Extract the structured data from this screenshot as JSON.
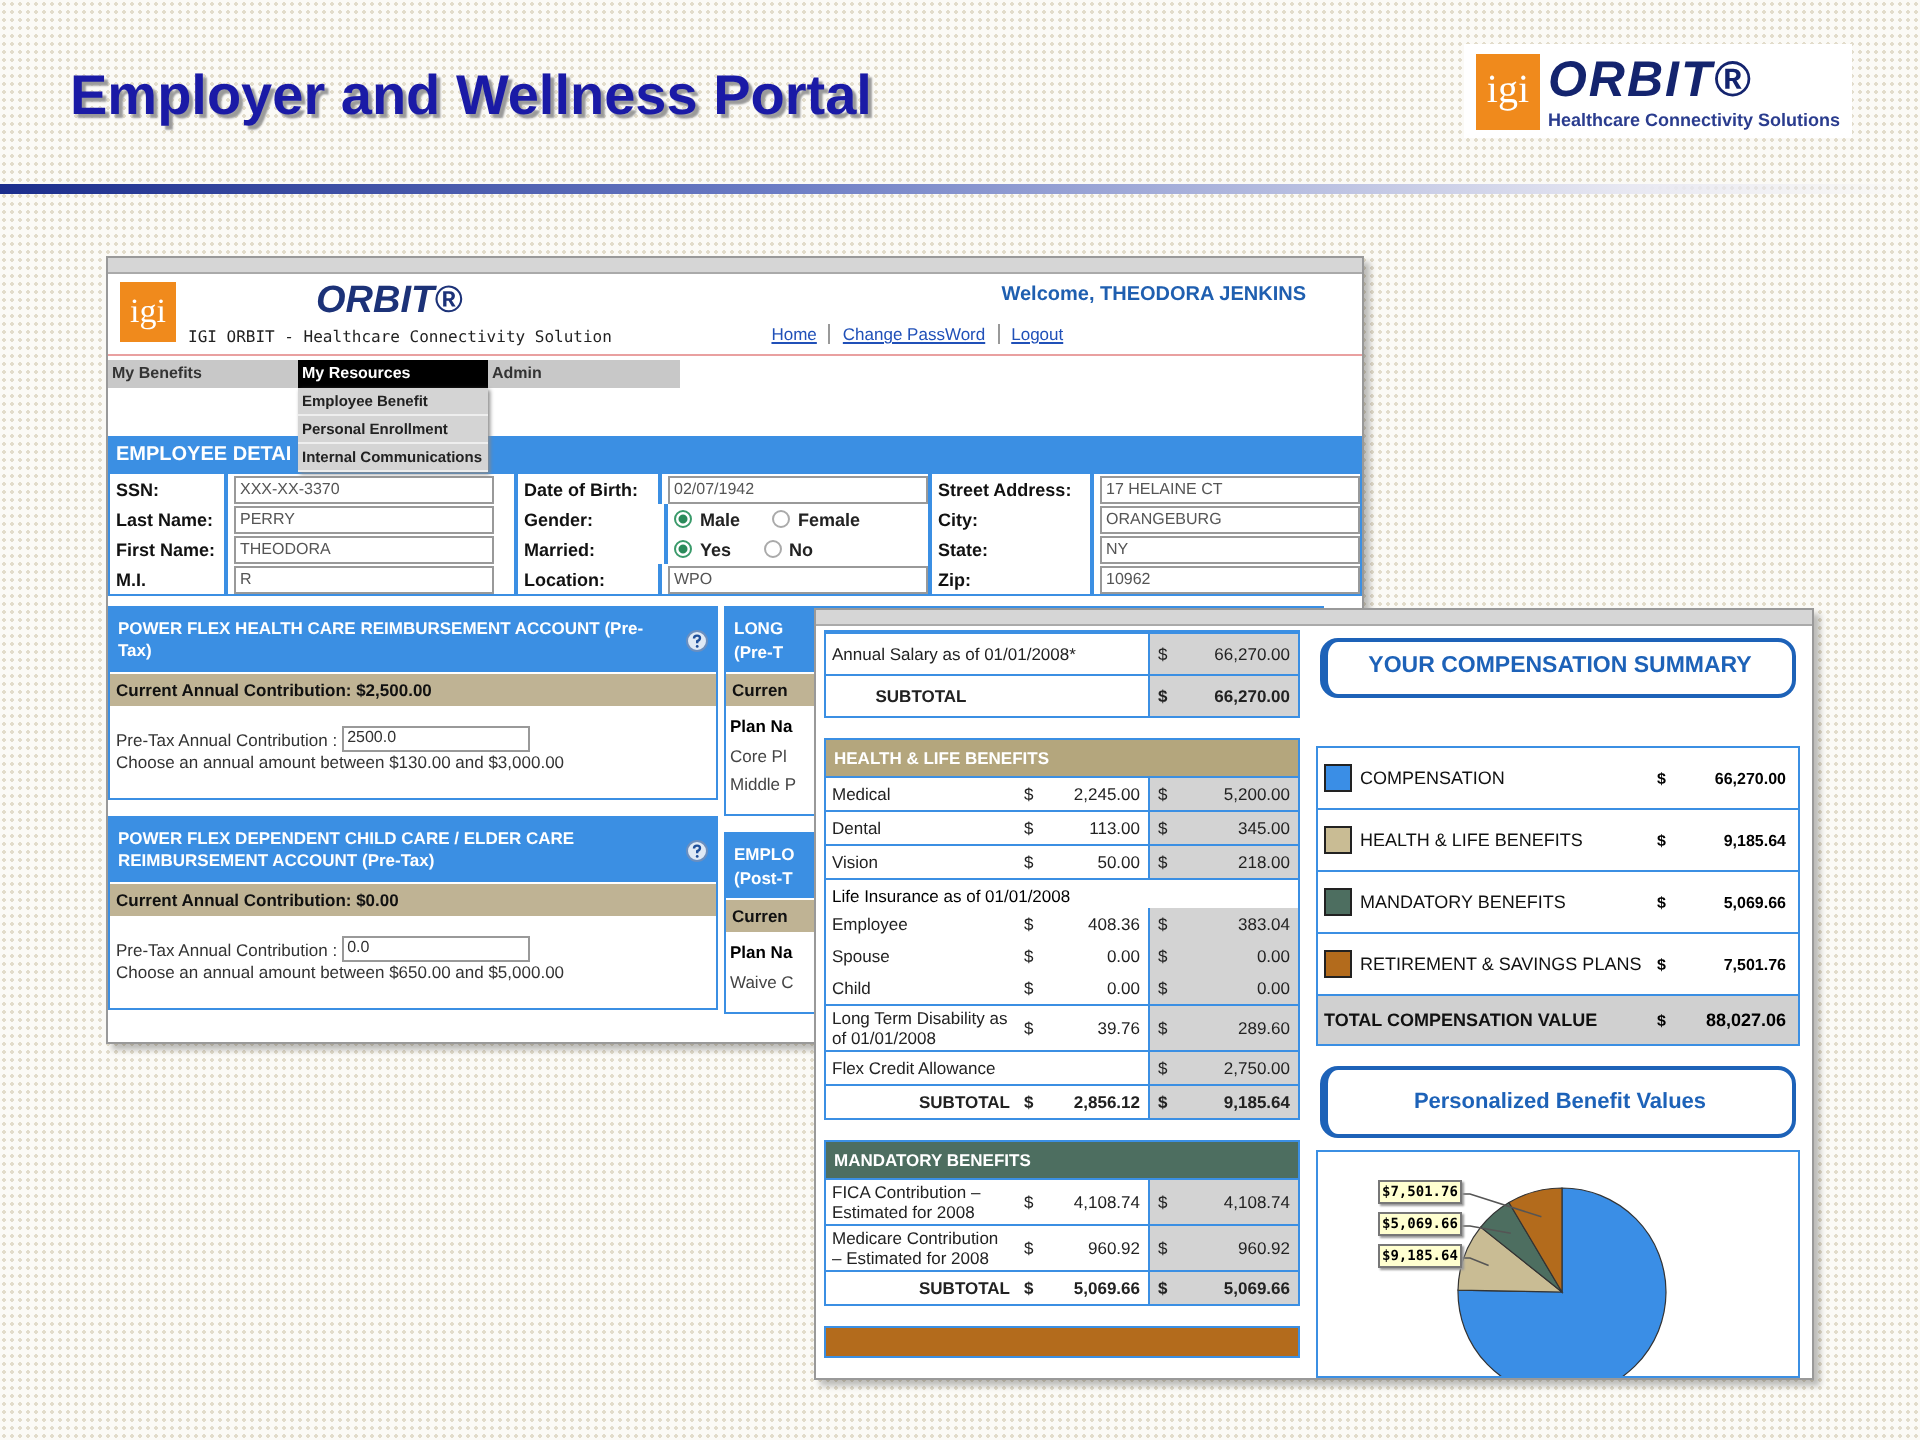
{
  "slide": {
    "title": "Employer and Wellness Portal",
    "logo": {
      "mark": "igi",
      "name": "ORBIT®",
      "tagline": "Healthcare Connectivity Solutions"
    }
  },
  "portal_window": {
    "logo": {
      "mark": "igi",
      "name": "ORBIT®",
      "tagline": "IGI ORBIT - Healthcare Connectivity Solution"
    },
    "welcome": "Welcome, THEODORA JENKINS",
    "links": [
      "Home",
      "Change PassWord",
      "Logout"
    ],
    "nav": [
      {
        "label": "My Benefits",
        "selected": false
      },
      {
        "label": "My Resources",
        "selected": true
      },
      {
        "label": "Admin",
        "selected": false
      }
    ],
    "dropdown": [
      "Employee Benefit",
      "Personal Enrollment",
      "Internal Communications"
    ],
    "section_title": "EMPLOYEE DETAI",
    "field_columns": [
      [
        {
          "label": "SSN:",
          "kind": "text",
          "value": "XXX-XX-3370"
        },
        {
          "label": "Last Name:",
          "kind": "text",
          "value": "PERRY"
        },
        {
          "label": "First Name:",
          "kind": "text",
          "value": "THEODORA"
        },
        {
          "label": "M.I.",
          "kind": "text",
          "value": "R"
        }
      ],
      [
        {
          "label": "Date of Birth:",
          "kind": "text",
          "value": "02/07/1942"
        },
        {
          "label": "Gender:",
          "kind": "radio",
          "options": [
            {
              "label": "Male",
              "selected": true
            },
            {
              "label": "Female",
              "selected": false
            }
          ]
        },
        {
          "label": "Married:",
          "kind": "radio",
          "options": [
            {
              "label": "Yes",
              "selected": true
            },
            {
              "label": "No",
              "selected": false
            }
          ]
        },
        {
          "label": "Location:",
          "kind": "text",
          "value": "WPO"
        }
      ],
      [
        {
          "label": "Street Address:",
          "kind": "text",
          "value": "17 HELAINE CT"
        },
        {
          "label": "City:",
          "kind": "text",
          "value": "ORANGEBURG"
        },
        {
          "label": "State:",
          "kind": "text",
          "value": "NY"
        },
        {
          "label": "Zip:",
          "kind": "text",
          "value": "10962"
        }
      ]
    ],
    "panels": [
      {
        "title": "POWER FLEX HEALTH CARE REIMBURSEMENT ACCOUNT (Pre-Tax)",
        "contribution": "Current Annual Contribution: $2,500.00",
        "field_label": "Pre-Tax Annual Contribution :",
        "value": "2500.0",
        "hint": "Choose an annual amount between $130.00 and $3,000.00"
      },
      {
        "title": "POWER FLEX DEPENDENT CHILD CARE / ELDER CARE REIMBURSEMENT ACCOUNT (Pre-Tax)",
        "contribution": "Current Annual Contribution: $0.00",
        "field_label": "Pre-Tax Annual Contribution :",
        "value": "0.0",
        "hint": "Choose an annual amount between $650.00 and $5,000.00"
      }
    ],
    "partial_panels": [
      {
        "title": "LONG",
        "subtitle": "(Pre-T",
        "contribution": "Curren",
        "plan_header": "Plan Na",
        "rows": [
          "Core Pl",
          "Middle P"
        ]
      },
      {
        "title": "EMPLO",
        "subtitle": "(Post-T",
        "contribution": "Curren",
        "plan_header": "Plan Na",
        "rows": [
          "Waive C"
        ]
      }
    ]
  },
  "summary_window": {
    "salary": {
      "rows": [
        {
          "label": "Annual Salary as of 01/01/2008*",
          "employer": [
            "$",
            "66,270.00"
          ]
        }
      ],
      "subtotal": {
        "label": "SUBTOTAL",
        "employer": [
          "$",
          "66,270.00"
        ]
      }
    },
    "health": {
      "title": "HEALTH & LIFE BENEFITS",
      "rows": [
        {
          "label": "Medical",
          "employee": [
            "$",
            "2,245.00"
          ],
          "employer": [
            "$",
            "5,200.00"
          ]
        },
        {
          "label": "Dental",
          "employee": [
            "$",
            "113.00"
          ],
          "employer": [
            "$",
            "345.00"
          ]
        },
        {
          "label": "Vision",
          "employee": [
            "$",
            "50.00"
          ],
          "employer": [
            "$",
            "218.00"
          ]
        },
        {
          "label": "Life Insurance as of 01/01/2008",
          "children": [
            {
              "label": "Employee",
              "employee": [
                "$",
                "408.36"
              ],
              "employer": [
                "$",
                "383.04"
              ]
            },
            {
              "label": "Spouse",
              "employee": [
                "$",
                "0.00"
              ],
              "employer": [
                "$",
                "0.00"
              ]
            },
            {
              "label": "Child",
              "employee": [
                "$",
                "0.00"
              ],
              "employer": [
                "$",
                "0.00"
              ]
            }
          ]
        },
        {
          "label": "Long Term Disability as of 01/01/2008",
          "employee": [
            "$",
            "39.76"
          ],
          "employer": [
            "$",
            "289.60"
          ]
        },
        {
          "label": "Flex Credit Allowance",
          "employer": [
            "$",
            "2,750.00"
          ]
        }
      ],
      "subtotal": {
        "label": "SUBTOTAL",
        "employee": [
          "$",
          "2,856.12"
        ],
        "employer": [
          "$",
          "9,185.64"
        ]
      }
    },
    "mandatory": {
      "title": "MANDATORY BENEFITS",
      "rows": [
        {
          "label": "FICA Contribution – Estimated for 2008",
          "employee": [
            "$",
            "4,108.74"
          ],
          "employer": [
            "$",
            "4,108.74"
          ]
        },
        {
          "label": "Medicare Contribution – Estimated for 2008",
          "employee": [
            "$",
            "960.92"
          ],
          "employer": [
            "$",
            "960.92"
          ]
        }
      ],
      "subtotal": {
        "label": "SUBTOTAL",
        "employee": [
          "$",
          "5,069.66"
        ],
        "employer": [
          "$",
          "5,069.66"
        ]
      }
    },
    "summary_title": "YOUR COMPENSATION SUMMARY",
    "summary": [
      {
        "label": "COMPENSATION",
        "currency": "$",
        "amount": "66,270.00",
        "color": "#3a8ee6"
      },
      {
        "label": "HEALTH & LIFE BENEFITS",
        "currency": "$",
        "amount": "9,185.64",
        "color": "#c9bc94"
      },
      {
        "label": "MANDATORY BENEFITS",
        "currency": "$",
        "amount": "5,069.66",
        "color": "#4d6e60"
      },
      {
        "label": "RETIREMENT & SAVINGS PLANS",
        "currency": "$",
        "amount": "7,501.76",
        "color": "#b36b1c"
      }
    ],
    "total": {
      "label": "TOTAL COMPENSATION VALUE",
      "currency": "$",
      "amount": "88,027.06"
    },
    "chart_title": "Personalized Benefit Values",
    "chart_data": {
      "type": "pie",
      "values": [
        66270.0,
        9185.64,
        5069.66,
        7501.76
      ],
      "colors": [
        "#3a8ee6",
        "#c9bc94",
        "#4d6e60",
        "#b36b1c"
      ],
      "value_labels": [
        null,
        "$9,185.64",
        "$5,069.66",
        "$7,501.76"
      ]
    }
  }
}
